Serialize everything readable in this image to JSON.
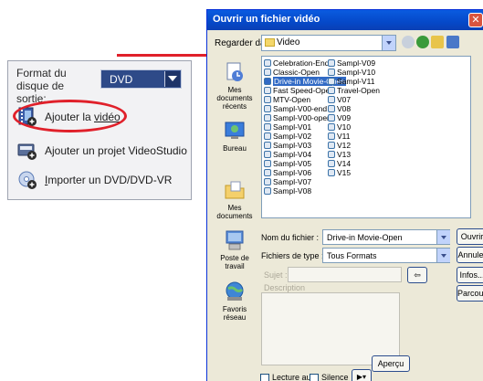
{
  "left_panel": {
    "format_label": "Format du disque de sortie:",
    "format_value": "DVD",
    "actions": [
      {
        "label": "Ajouter la ",
        "underlined": "vidéo"
      },
      {
        "label": "Ajouter un projet VideoStudio"
      },
      {
        "underlined": "I",
        "label": "mporter un DVD/DVD-VR"
      }
    ]
  },
  "dialog": {
    "title": "Ouvrir un fichier vidéo",
    "close_glyph": "✕",
    "look_in_label": "Regarder dans :",
    "look_in_value": "Video",
    "places": [
      "Mes documents récents",
      "Bureau",
      "Mes documents",
      "Poste de travail",
      "Favoris réseau"
    ],
    "files_col1": [
      "Celebration-End",
      "Classic-Open",
      "Drive-in Movie-Open",
      "Fast Speed-Open",
      "MTV-Open",
      "Sampl-V00-end",
      "Sampl-V00-open",
      "Sampl-V01",
      "Sampl-V02",
      "Sampl-V03",
      "Sampl-V04",
      "Sampl-V05",
      "Sampl-V06",
      "Sampl-V07",
      "Sampl-V08"
    ],
    "files_col2": [
      "Sampl-V09",
      "Sampl-V10",
      "Sampl-V11",
      "Travel-Open",
      "V07",
      "V08",
      "V09",
      "V10",
      "V11",
      "V12",
      "V13",
      "V14",
      "V15"
    ],
    "selected_file": "Drive-in Movie-Open",
    "filename_label": "Nom du fichier :",
    "filename_value": "Drive-in Movie-Open",
    "filetype_label": "Fichiers de type :",
    "filetype_value": "Tous Formats",
    "subject_label": "Sujet :",
    "description_label": "Description",
    "open_button": "Ouvrir",
    "cancel_button": "Annuler",
    "info_button": "Infos...",
    "browse_button": "Parcourir...",
    "preview_button": "Aperçu",
    "autoplay_label": "Lecture auto",
    "mute_label": "Silence"
  }
}
